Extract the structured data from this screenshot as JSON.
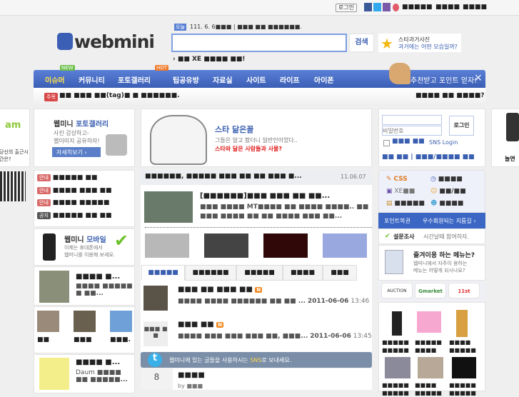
{
  "topbar": {
    "login": "로그인",
    "links": [
      "■■■■■",
      "■■■■",
      "■■■■"
    ],
    "icons": [
      "facebook-icon",
      "twitter-icon",
      "me2day-icon",
      "yozm-icon"
    ]
  },
  "header": {
    "today_badge": "오늘",
    "date_line": "111. 6. 6■■■ | ■■■ ■■ ■■■■■■.",
    "logo": "webmini",
    "search_button": "검색",
    "search_value": "",
    "star_ad_title": "스타과거사진",
    "star_ad_sub": "과거에는 어떤 모습일까?",
    "notice": "› ■■ XE ■■■■ ■■!"
  },
  "nav": {
    "items": [
      "이슈머",
      "커뮤니티",
      "포토갤러리",
      "팁공유방",
      "자료실",
      "사이트",
      "라이프",
      "아이폰"
    ],
    "new": "NEW",
    "hot": "HOT",
    "promo": "추천받고 포인트 얻자!",
    "close": "×"
  },
  "subbar": {
    "tag": "주목",
    "text": "■■ ■■■ ■■(tag)■ ■ ■■■■■■.",
    "right": "■■■■ ■■ ■■■■?"
  },
  "ads": {
    "gam_text": "당신의 출근시간은?",
    "gam_logo": "am",
    "photo_badge": "안내",
    "photo_title1": "웹미니 ",
    "photo_title2": "포토갤러리",
    "photo_sub1": "사진 감상하고-",
    "photo_sub2": "웹이미지 공유하자!",
    "photo_btn": "자세히보기 ›",
    "star_title": "스타 닮은꼴",
    "star_sub": "그들은 알고 봤더니 일반인이었다..",
    "star_red": "스타와 닮은 사람들과 사물?",
    "phone_text": "놀면"
  },
  "login": {
    "id_value": "",
    "pw_placeholder": "비밀번호",
    "button": "로그인",
    "remember": "■■■ ■■",
    "sns": "SNS Login",
    "links": "■■ ■■ | ■■■/■■■■ ■■"
  },
  "notices": [
    {
      "tag": "안내",
      "text": "■■■■■ ■■"
    },
    {
      "tag": "안내",
      "text": "■■■■ ■■■ ■■"
    },
    {
      "tag": "안내",
      "text": "■■■■ ■■■■■"
    },
    {
      "tag": "공지",
      "text": "■■■■■ ■■ ■■"
    }
  ],
  "headline": {
    "text": "■■■■■■, ■■■■■ ■■■ ■■ ■■ ■■■ ■...",
    "date": "11.06.07"
  },
  "article": {
    "title": "[■■■■■■]■■■ ■■■ ■■ ■■...",
    "body1": "■■■ ■■■■ MT■■■■ ■■ ■■■■ ■■■■.. ■■",
    "body2": "■■■ ■■■■ ■■ ■■ ■■■■ ■■■ ■■..."
  },
  "mobile_ad": {
    "title1": "웹미니 ",
    "title2": "모바일",
    "sub1": "이제는 휴대폰에서",
    "sub2": "웹미니를 이용해 보세요."
  },
  "left_items": [
    {
      "title": "■■■■ ■...",
      "body": "■■■■ ■■■■■ ■ ■■..."
    },
    {
      "title": "■■■■ ■...",
      "pre": "Daum",
      "body": "■■■■ ■■ ■■■■■..."
    }
  ],
  "left_thumbs": [
    "■■",
    "■■■",
    "■■■."
  ],
  "tabs": [
    "■■■■■",
    "■■■■■■",
    "■■■■■",
    "■■■■",
    "■■■"
  ],
  "posts": [
    {
      "title": "■■■ ■■ ■■■ ■■",
      "body": "■■■■ ■■■■ ■■■■■■ ■■ ■■ ...",
      "date": "2011-06-06",
      "time": "13:46",
      "thumb": "",
      "new": "N"
    },
    {
      "title": "■■■ ■■",
      "body": "■■■■ ■■■ ■■■ ■■■ ■■, ■■■...",
      "date": "2011-06-06",
      "time": "13:45",
      "thumb": "■■■ ■ ■",
      "new": "N"
    }
  ],
  "sns_bar": {
    "text1": "웹미니에 있는 글들을 사용하시는 ",
    "sns": "SNS",
    "text2": "로 보내세요."
  },
  "bottom_post": {
    "count": "8",
    "title": "■■■■",
    "by": "by ■■■"
  },
  "quick": [
    {
      "icon": "css-icon",
      "label": "CSS"
    },
    {
      "icon": "clock-icon",
      "label": "■■■■"
    },
    {
      "icon": "save-icon",
      "label": "XE■■"
    },
    {
      "icon": "smile-icon",
      "label": "■■/■■"
    },
    {
      "icon": "image-icon",
      "label": "■■■■■"
    },
    {
      "icon": "users-icon",
      "label": "■■■■"
    }
  ],
  "point_bar": {
    "left": "포인트복권",
    "right": "우수회원되는 지름길 ›"
  },
  "survey": {
    "label": "설문조사",
    "text": "시간날때 참여하자."
  },
  "fav": {
    "title": "즐겨이용 하는 메뉴는?",
    "sub1": "웹미니에서 자주이 용하는",
    "sub2": "메뉴는 어떻게 되시나요?"
  },
  "shops": [
    "AUCTION",
    "Gmarket",
    "11st"
  ],
  "products": [
    {
      "name": "■■■■■ ■■■■■"
    },
    {
      "name": "■■■■■ ■■■■"
    },
    {
      "name": "■■■■ ■■■■■"
    },
    {
      "name": "■■■■■ ■■■■■"
    },
    {
      "name": "■■■■ ■■■■■"
    },
    {
      "name": "■■■■■ ■■■■■"
    }
  ],
  "colors": {
    "nav": "#3b5fb5",
    "accent": "#3a5fb0",
    "red": "#d94848"
  }
}
